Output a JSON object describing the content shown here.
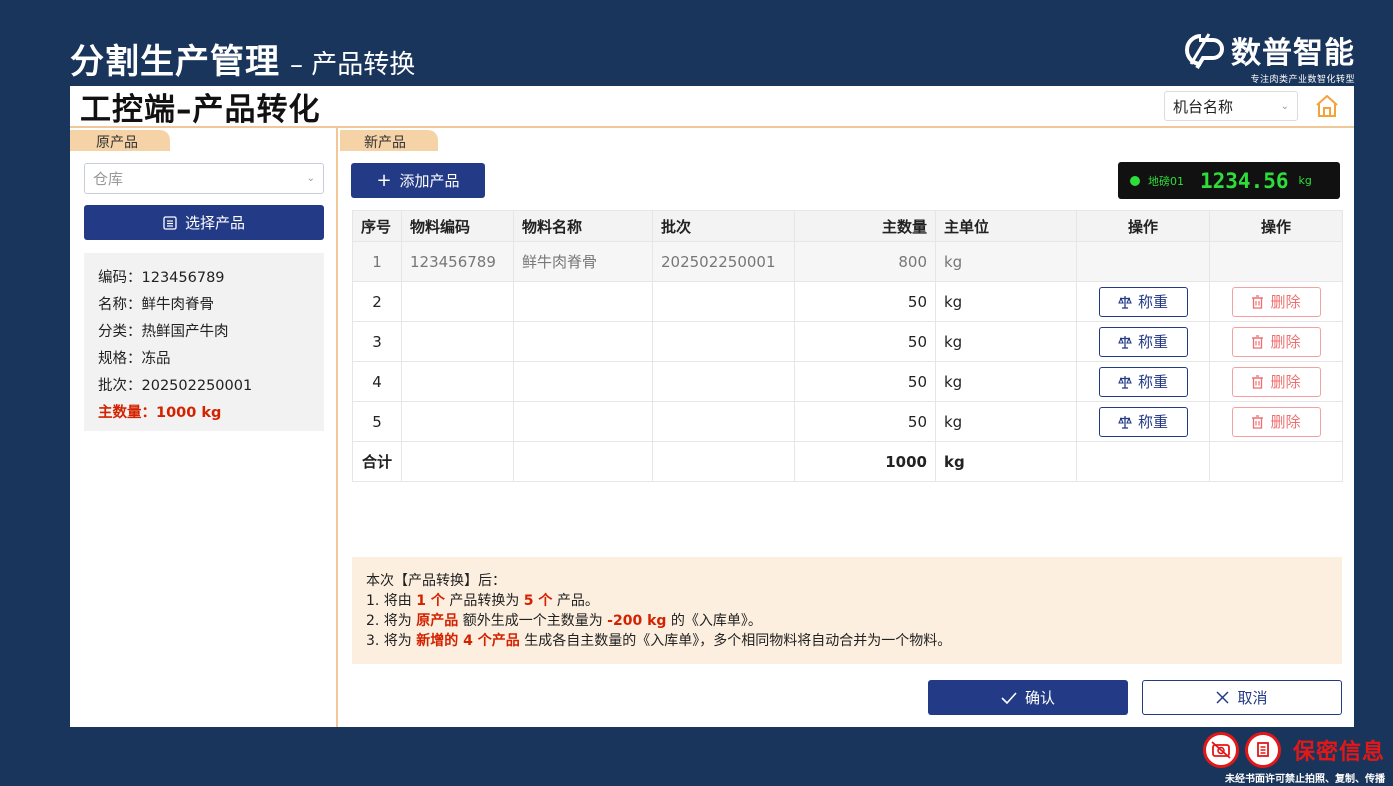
{
  "page": {
    "title": "分割生产管理",
    "subtitle": "– 产品转换"
  },
  "logo": {
    "name": "数普智能",
    "slogan": "专注肉类产业数智化转型"
  },
  "app": {
    "title": "工控端–产品转化",
    "machine_select": "机台名称"
  },
  "left": {
    "tab": "原产品",
    "warehouse_placeholder": "仓库",
    "select_button": "选择产品",
    "info": {
      "code": "编码：123456789",
      "name": "名称：鲜牛肉脊骨",
      "category": "分类：热鲜国产牛肉",
      "spec": "规格：冻品",
      "batch": "批次：202502250001",
      "quantity": "主数量：1000 kg"
    }
  },
  "right": {
    "tab": "新产品",
    "add_button": "添加产品",
    "scale": {
      "name": "地磅01",
      "weight": "1234.56",
      "unit": "kg",
      "status_color": "#2fdd3a"
    },
    "table": {
      "headers": [
        "序号",
        "物料编码",
        "物料名称",
        "批次",
        "主数量",
        "主单位",
        "操作",
        "操作"
      ],
      "rows": [
        {
          "no": "1",
          "code": "123456789",
          "name": "鲜牛肉脊骨",
          "batch": "202502250001",
          "qty": "800",
          "unit": "kg"
        },
        {
          "no": "2",
          "code": "",
          "name": "",
          "batch": "",
          "qty": "50",
          "unit": "kg",
          "weigh": "称重",
          "delete": "删除"
        },
        {
          "no": "3",
          "code": "",
          "name": "",
          "batch": "",
          "qty": "50",
          "unit": "kg",
          "weigh": "称重",
          "delete": "删除"
        },
        {
          "no": "4",
          "code": "",
          "name": "",
          "batch": "",
          "qty": "50",
          "unit": "kg",
          "weigh": "称重",
          "delete": "删除"
        },
        {
          "no": "5",
          "code": "",
          "name": "",
          "batch": "",
          "qty": "50",
          "unit": "kg",
          "weigh": "称重",
          "delete": "删除"
        }
      ],
      "total": {
        "label": "合计",
        "qty": "1000",
        "unit": "kg"
      }
    },
    "notes": {
      "intro": "本次【产品转换】后：",
      "l1_a": "1. 将由 ",
      "l1_b": "1 个",
      "l1_c": " 产品转换为 ",
      "l1_d": "5 个",
      "l1_e": " 产品。",
      "l2_a": "2. 将为 ",
      "l2_b": "原产品",
      "l2_c": " 额外生成一个主数量为 ",
      "l2_d": "-200 kg",
      "l2_e": " 的《入库单》。",
      "l3_a": "3. 将为 ",
      "l3_b": "新增的 4 个产品",
      "l3_c": " 生成各自主数量的《入库单》，多个相同物料将自动合并为一个物料。"
    },
    "confirm_button": "确认",
    "cancel_button": "取消"
  },
  "confidential": {
    "label": "保密信息",
    "note": "未经书面许可禁止拍照、复制、传播"
  },
  "colors": {
    "primary": "#233a86",
    "accent": "#f6d3a6",
    "highlight": "#d32200",
    "background": "#1a355b"
  }
}
